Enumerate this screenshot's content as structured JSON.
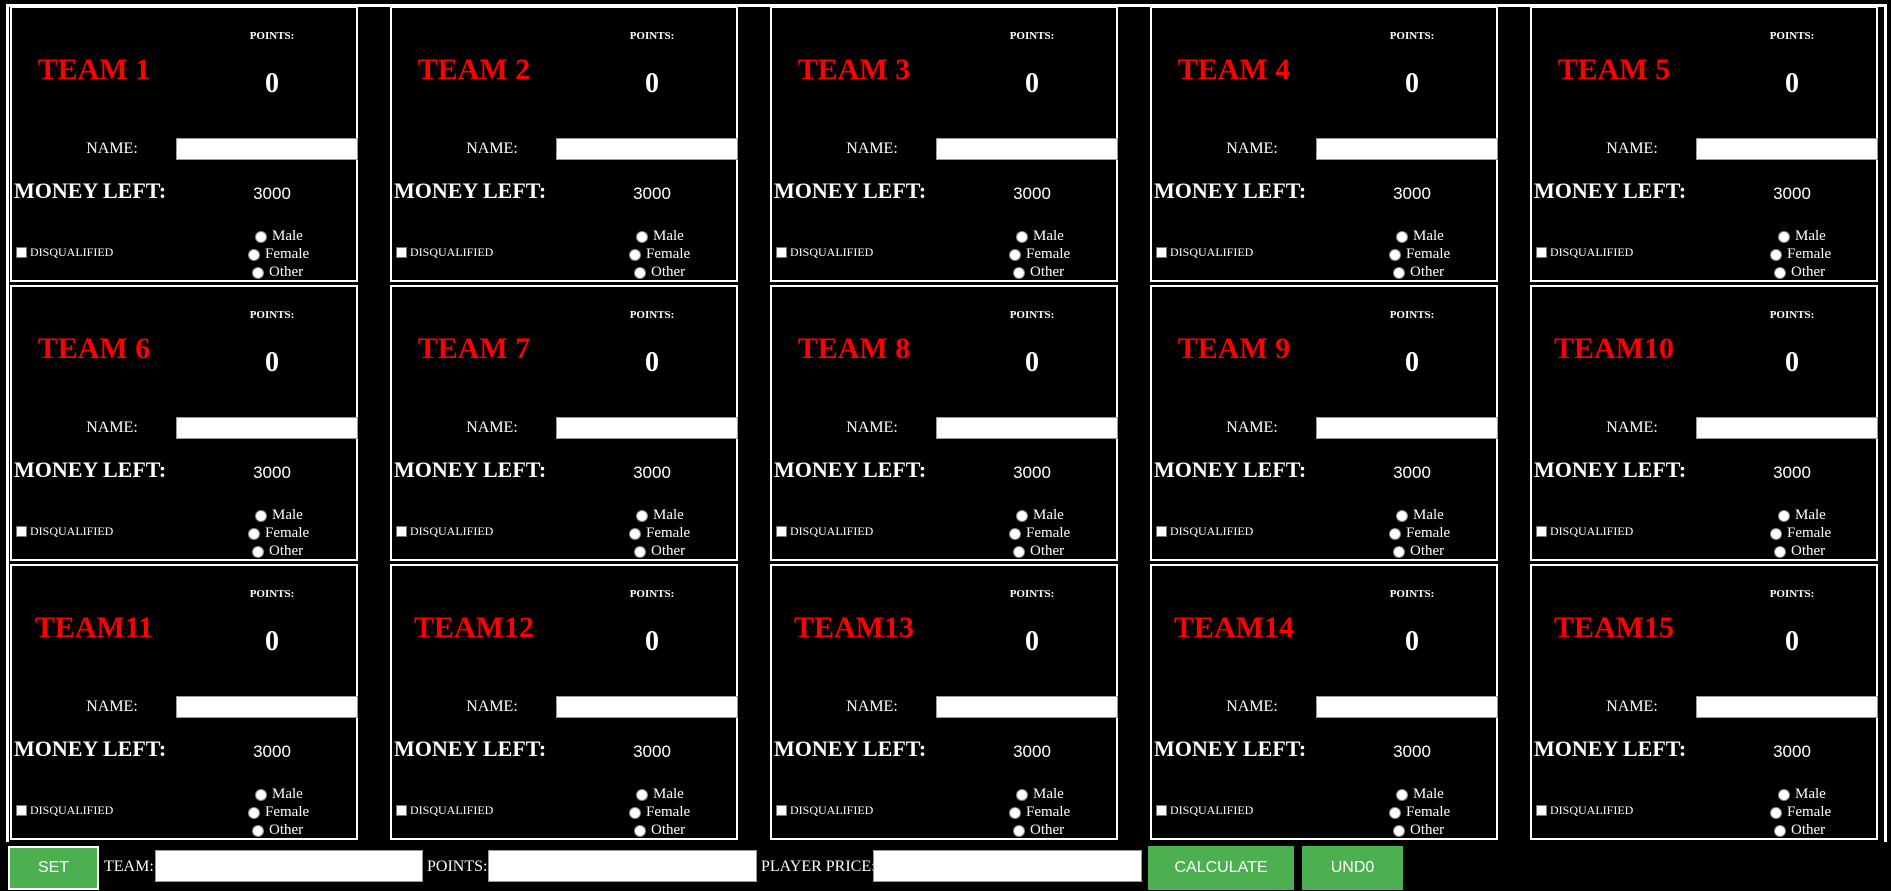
{
  "labels": {
    "points": "POINTS:",
    "name": "NAME:",
    "money_left": "MONEY LEFT:",
    "disqualified": "DISQUALIFIED",
    "male": "Male",
    "female": "Female",
    "other": "Other"
  },
  "teams": [
    {
      "name": "TEAM 1",
      "points": "0",
      "money_left": "3000",
      "player_name": ""
    },
    {
      "name": "TEAM 2",
      "points": "0",
      "money_left": "3000",
      "player_name": ""
    },
    {
      "name": "TEAM 3",
      "points": "0",
      "money_left": "3000",
      "player_name": ""
    },
    {
      "name": "TEAM 4",
      "points": "0",
      "money_left": "3000",
      "player_name": ""
    },
    {
      "name": "TEAM 5",
      "points": "0",
      "money_left": "3000",
      "player_name": ""
    },
    {
      "name": "TEAM 6",
      "points": "0",
      "money_left": "3000",
      "player_name": ""
    },
    {
      "name": "TEAM 7",
      "points": "0",
      "money_left": "3000",
      "player_name": ""
    },
    {
      "name": "TEAM 8",
      "points": "0",
      "money_left": "3000",
      "player_name": ""
    },
    {
      "name": "TEAM 9",
      "points": "0",
      "money_left": "3000",
      "player_name": ""
    },
    {
      "name": "TEAM10",
      "points": "0",
      "money_left": "3000",
      "player_name": ""
    },
    {
      "name": "TEAM11",
      "points": "0",
      "money_left": "3000",
      "player_name": ""
    },
    {
      "name": "TEAM12",
      "points": "0",
      "money_left": "3000",
      "player_name": ""
    },
    {
      "name": "TEAM13",
      "points": "0",
      "money_left": "3000",
      "player_name": ""
    },
    {
      "name": "TEAM14",
      "points": "0",
      "money_left": "3000",
      "player_name": ""
    },
    {
      "name": "TEAM15",
      "points": "0",
      "money_left": "3000",
      "player_name": ""
    }
  ],
  "controls": {
    "set_label": "SET",
    "team_label": "TEAM:",
    "team_value": "",
    "points_label": "POINTS:",
    "points_value": "",
    "player_price_label": "PLAYER PRICE:",
    "player_price_value": "",
    "calculate_label": "CALCULATE",
    "undo_label": "UND0"
  },
  "colors": {
    "background": "#000000",
    "team_name": "#ff0000",
    "button": "#4caf50"
  }
}
